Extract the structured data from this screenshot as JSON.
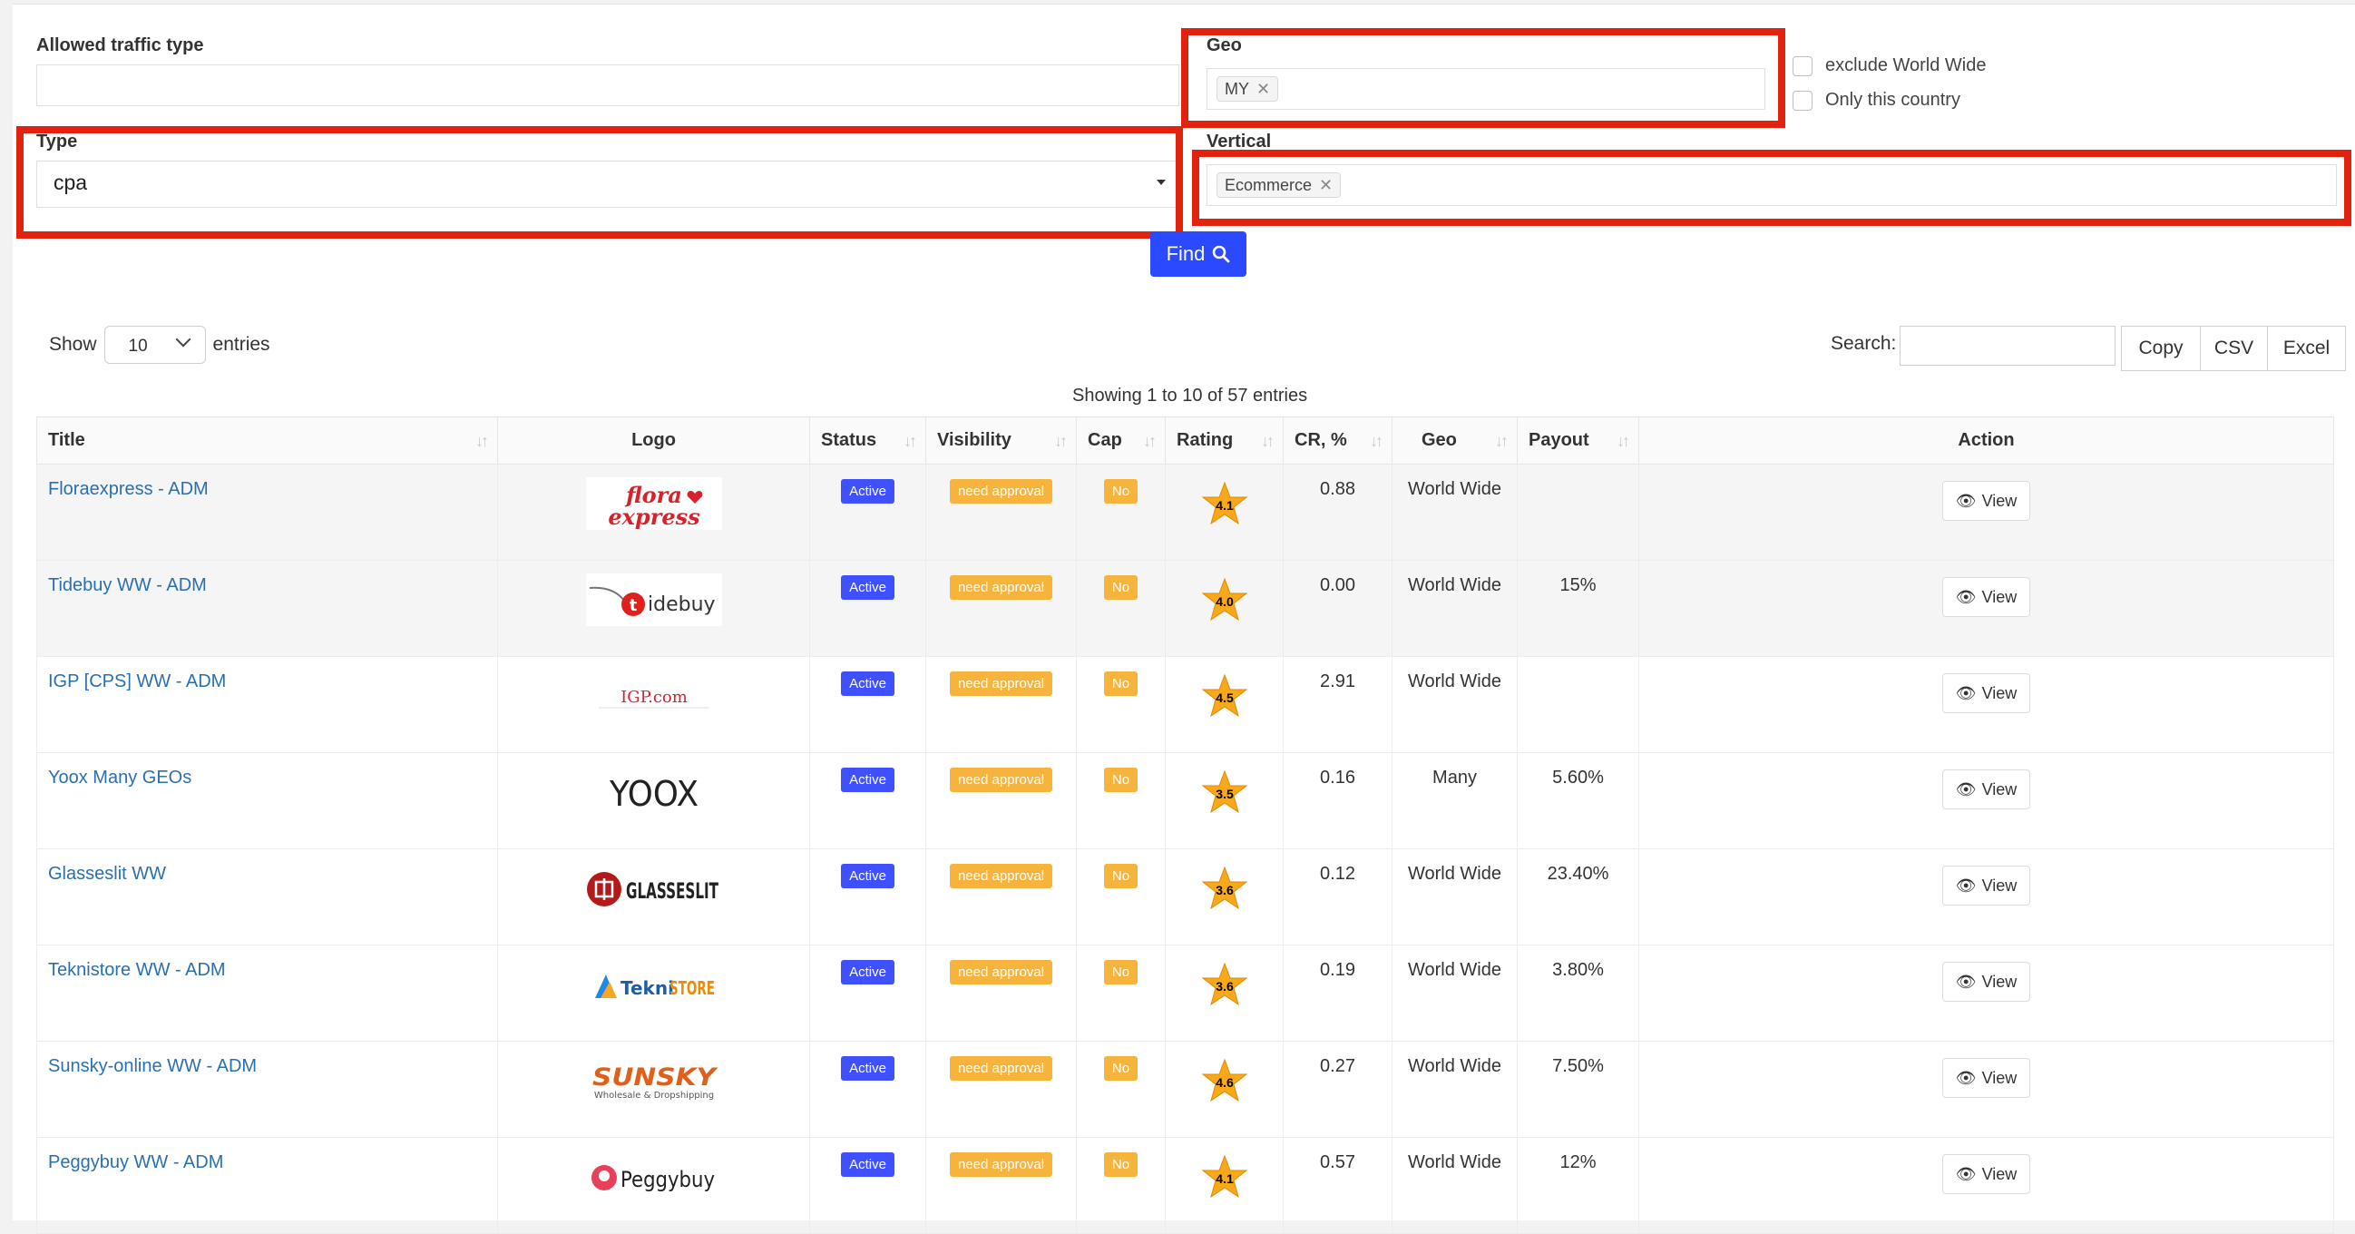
{
  "filters": {
    "allowed_traffic_label": "Allowed traffic type",
    "allowed_traffic_value": "",
    "type_label": "Type",
    "type_value": "cpa",
    "geo_label": "Geo",
    "geo_tag": "MY",
    "vertical_label": "Vertical",
    "vertical_tag": "Ecommerce",
    "exclude_ww_label": "exclude World Wide",
    "only_country_label": "Only this country",
    "find_label": "Find"
  },
  "table_controls": {
    "show_label": "Show",
    "entries_label": "entries",
    "page_length": "10",
    "search_label": "Search:",
    "search_value": "",
    "buttons": [
      "Copy",
      "CSV",
      "Excel"
    ],
    "info": "Showing 1 to 10 of 57 entries"
  },
  "columns": [
    "Title",
    "Logo",
    "Status",
    "Visibility",
    "Cap",
    "Rating",
    "CR, %",
    "Geo",
    "Payout",
    "Action"
  ],
  "rows": [
    {
      "title": "Floraexpress - ADM",
      "logo": "flora express",
      "status": "Active",
      "visibility": "need approval",
      "cap": "No",
      "rating": "4.1",
      "cr": "0.88",
      "geo": "World Wide",
      "payout": "",
      "action": "View"
    },
    {
      "title": "Tidebuy WW - ADM",
      "logo": "tidebuy",
      "status": "Active",
      "visibility": "need approval",
      "cap": "No",
      "rating": "4.0",
      "cr": "0.00",
      "geo": "World Wide",
      "payout": "15%",
      "action": "View"
    },
    {
      "title": "IGP [CPS] WW - ADM",
      "logo": "IGP.com",
      "status": "Active",
      "visibility": "need approval",
      "cap": "No",
      "rating": "4.5",
      "cr": "2.91",
      "geo": "World Wide",
      "payout": "",
      "action": "View"
    },
    {
      "title": "Yoox Many GEOs",
      "logo": "YOOX",
      "status": "Active",
      "visibility": "need approval",
      "cap": "No",
      "rating": "3.5",
      "cr": "0.16",
      "geo": "Many",
      "payout": "5.60%",
      "action": "View"
    },
    {
      "title": "Glasseslit WW",
      "logo": "GLASSESLIT",
      "status": "Active",
      "visibility": "need approval",
      "cap": "No",
      "rating": "3.6",
      "cr": "0.12",
      "geo": "World Wide",
      "payout": "23.40%",
      "action": "View"
    },
    {
      "title": "Teknistore WW - ADM",
      "logo": "TekniSTORE",
      "status": "Active",
      "visibility": "need approval",
      "cap": "No",
      "rating": "3.6",
      "cr": "0.19",
      "geo": "World Wide",
      "payout": "3.80%",
      "action": "View"
    },
    {
      "title": "Sunsky-online WW - ADM",
      "logo": "SUNSKY",
      "logo_sub": "Wholesale & Dropshipping",
      "status": "Active",
      "visibility": "need approval",
      "cap": "No",
      "rating": "4.6",
      "cr": "0.27",
      "geo": "World Wide",
      "payout": "7.50%",
      "action": "View"
    },
    {
      "title": "Peggybuy WW - ADM",
      "logo": "Peggybuy",
      "status": "Active",
      "visibility": "need approval",
      "cap": "No",
      "rating": "4.1",
      "cr": "0.57",
      "geo": "World Wide",
      "payout": "12%",
      "action": "View"
    }
  ],
  "colors": {
    "accent": "#2b4aff",
    "highlight": "#e0220f",
    "badge_active": "#3f51ff",
    "badge_warn": "#f6b43c",
    "link": "#2a6fb0",
    "star": "#f7a81b"
  }
}
